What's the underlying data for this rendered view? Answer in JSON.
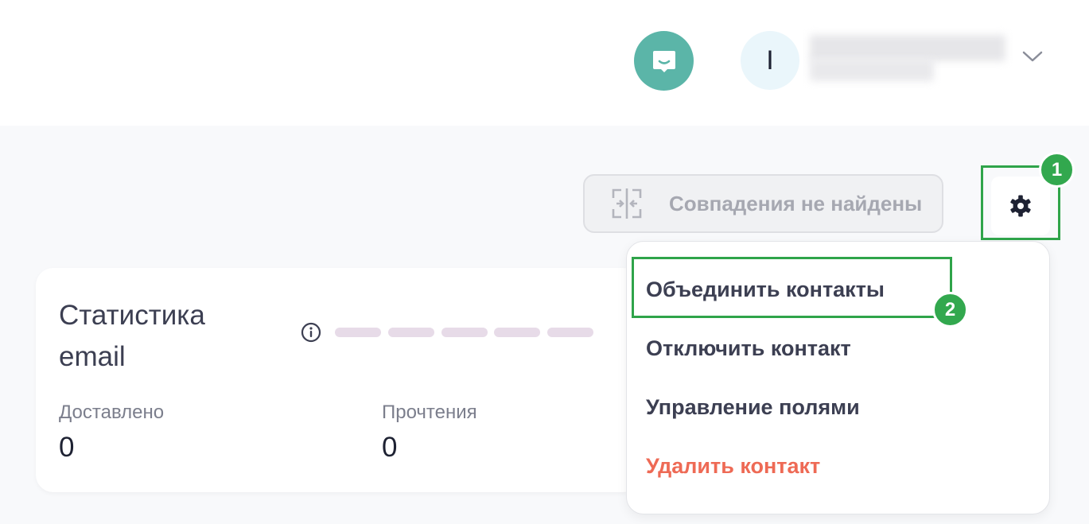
{
  "header": {
    "avatar_initial": "I",
    "user_name_redacted": true
  },
  "toolbar": {
    "match_label": "Совпадения не найдены"
  },
  "annotations": {
    "step1": "1",
    "step2": "2"
  },
  "stats": {
    "title": "Статистика email",
    "delivered_label": "Доставлено",
    "delivered_value": "0",
    "reads_label": "Прочтения",
    "reads_value": "0"
  },
  "menu": {
    "merge": "Объединить контакты",
    "disable": "Отключить контакт",
    "fields": "Управление полями",
    "delete": "Удалить контакт"
  },
  "colors": {
    "accent_teal": "#5bb5a8",
    "highlight_green": "#2fa44a",
    "danger": "#ee6a55"
  },
  "icons": [
    "chat-icon",
    "chevron-down-icon",
    "merge-icon",
    "gear-icon",
    "info-icon"
  ]
}
